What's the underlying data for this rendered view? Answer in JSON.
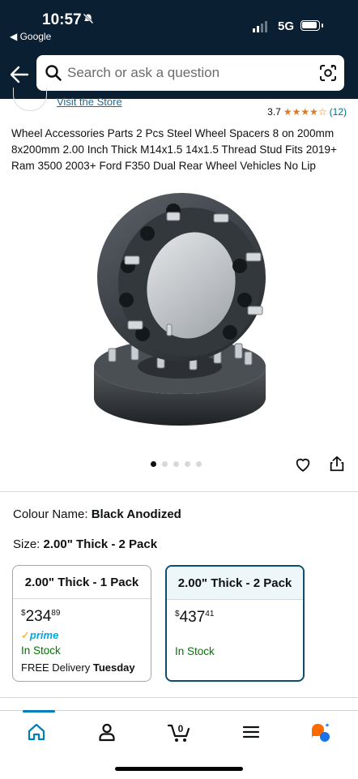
{
  "status_bar": {
    "time": "10:57",
    "back_app": "◀ Google",
    "network": "5G"
  },
  "search": {
    "placeholder": "Search or ask a question"
  },
  "store": {
    "link_text": "Visit the Store"
  },
  "rating": {
    "value": "3.7",
    "stars": "★★★★☆",
    "count": "(12)"
  },
  "product": {
    "title": "Wheel Accessories Parts 2 Pcs Steel Wheel Spacers 8 on 200mm 8x200mm 2.00 Inch Thick M14x1.5 14x1.5 Thread Stud Fits 2019+ Ram 3500 2003+ Ford F350 Dual Rear Wheel Vehicles No Lip"
  },
  "carousel": {
    "total": 5,
    "active_index": 0
  },
  "colour": {
    "label": "Colour Name:",
    "value": "Black Anodized"
  },
  "size": {
    "label": "Size:",
    "value": "2.00\" Thick - 2 Pack"
  },
  "options": [
    {
      "name": "2.00\" Thick - 1 Pack",
      "currency": "$",
      "price_whole": "234",
      "price_cents": "89",
      "prime": "prime",
      "stock": "In Stock",
      "delivery_prefix": "FREE Delivery ",
      "delivery_day": "Tuesday",
      "selected": false
    },
    {
      "name": "2.00\" Thick - 2 Pack",
      "currency": "$",
      "price_whole": "437",
      "price_cents": "41",
      "stock": "In Stock",
      "selected": true
    }
  ],
  "bottom_nav": {
    "cart_count": "0"
  },
  "colors": {
    "header_bg": "#0b1f33",
    "link": "#1f6b98",
    "star": "#de7921",
    "in_stock": "#007600",
    "selected_border": "#0b4f6c",
    "accent": "#007eb9"
  }
}
